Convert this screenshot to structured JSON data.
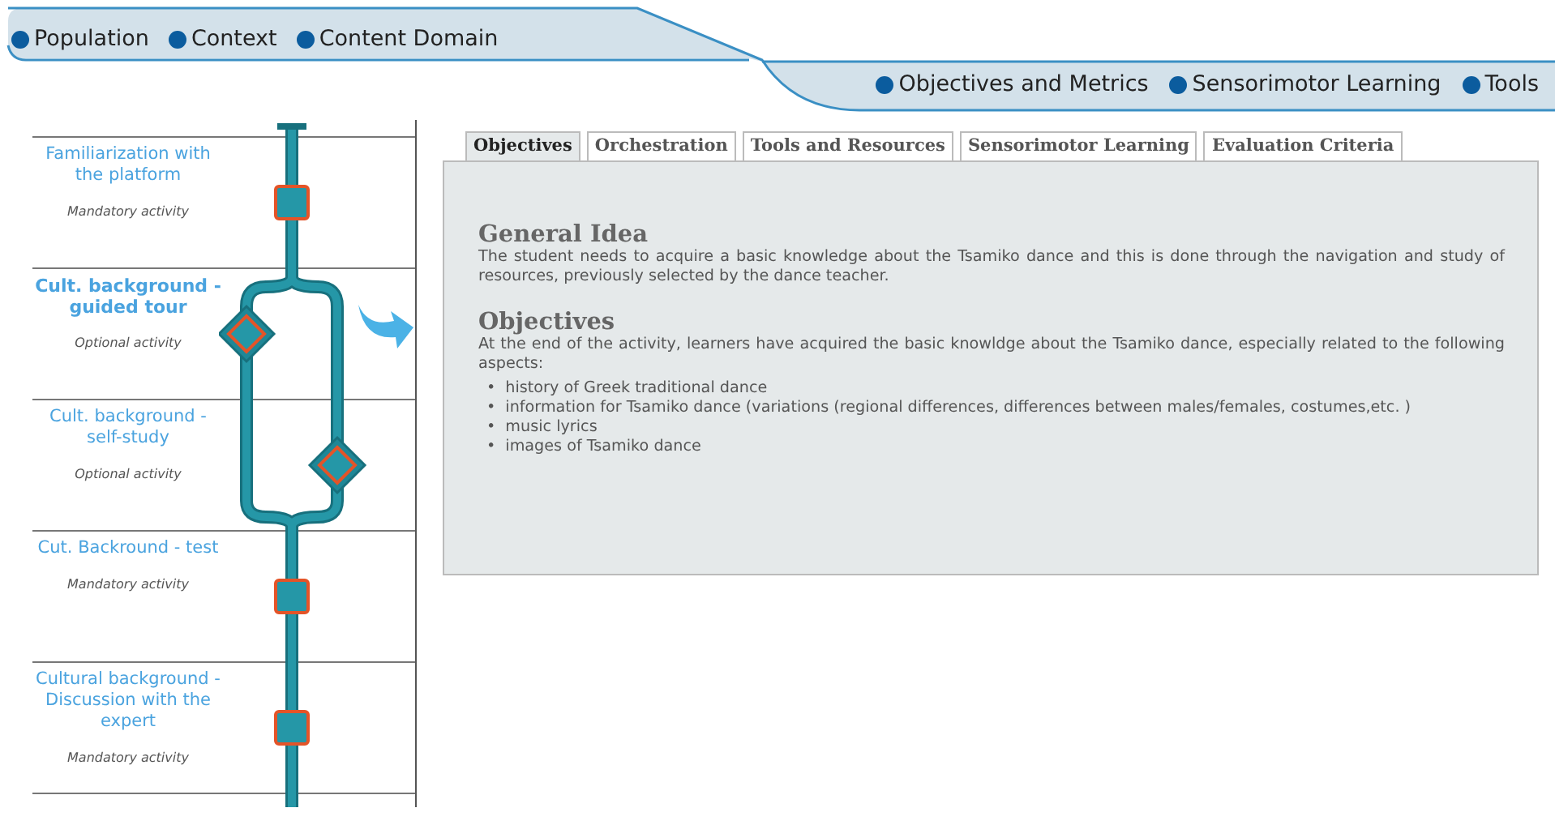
{
  "nav": {
    "primary": [
      {
        "label": "Population"
      },
      {
        "label": "Context"
      },
      {
        "label": "Content Domain"
      }
    ],
    "secondary": [
      {
        "label": "Objectives and Metrics"
      },
      {
        "label": "Sensorimotor Learning"
      },
      {
        "label": "Tools"
      }
    ]
  },
  "activities": [
    {
      "title": "Familiarization with the platform",
      "note": "Mandatory activity",
      "kind": "mandatory",
      "selected": false
    },
    {
      "title": "Cult. background - guided tour",
      "note": "Optional activity",
      "kind": "optional",
      "selected": true
    },
    {
      "title": "Cult. background - self-study",
      "note": "Optional activity",
      "kind": "optional",
      "selected": false
    },
    {
      "title": "Cut. Backround - test",
      "note": "Mandatory activity",
      "kind": "mandatory",
      "selected": false
    },
    {
      "title": "Cultural background - Discussion with the expert",
      "note": "Mandatory activity",
      "kind": "mandatory",
      "selected": false
    }
  ],
  "tabs": [
    {
      "label": "Objectives",
      "selected": true
    },
    {
      "label": "Orchestration",
      "selected": false
    },
    {
      "label": "Tools and Resources",
      "selected": false
    },
    {
      "label": "Sensorimotor Learning",
      "selected": false
    },
    {
      "label": "Evaluation Criteria",
      "selected": false
    }
  ],
  "sections": [
    {
      "heading": "General Idea",
      "text": "The student needs to acquire a basic knowledge about the Tsamiko dance and this is done through the navigation and study of resources, previously selected by the dance teacher."
    },
    {
      "heading": "Objectives",
      "text": "At the end of the activity, learners have acquired the basic knowldge about the Tsamiko dance, especially related to the following aspects:",
      "items": [
        {
          "marker": "•",
          "text": "history of Greek traditional dance"
        },
        {
          "marker": "•",
          "text": "information for Tsamiko dance (variations (regional differences, differences between males/females, costumes,etc. )"
        },
        {
          "marker": "•",
          "text": "music lyrics"
        },
        {
          "marker": "•",
          "text": "images of Tsamiko dance"
        }
      ]
    }
  ]
}
